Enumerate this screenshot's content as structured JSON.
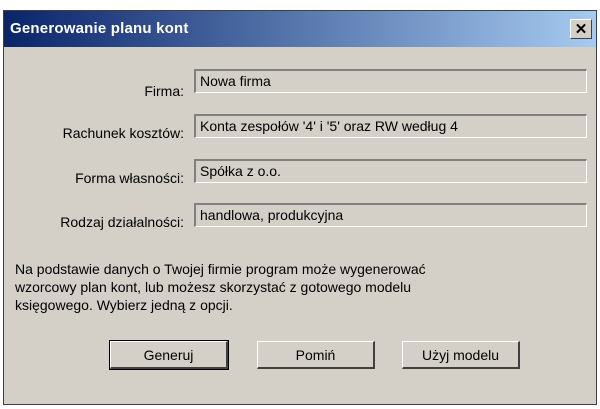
{
  "window": {
    "title": "Generowanie planu kont",
    "close_label": "✕"
  },
  "form": {
    "firma": {
      "label": "Firma:",
      "value": "Nowa firma"
    },
    "rachunek": {
      "label": "Rachunek kosztów:",
      "value": "Konta zespołów '4' i '5' oraz RW według 4"
    },
    "forma": {
      "label": "Forma własności:",
      "value": "Spółka z o.o."
    },
    "rodzaj": {
      "label": "Rodzaj działalności:",
      "value": "handlowa, produkcyjna"
    }
  },
  "info_lines": [
    "Na podstawie danych o Twojej firmie program może wygenerować",
    "wzorcowy plan kont, lub możesz skorzystać z gotowego modelu",
    "księgowego. Wybierz jedną z opcji."
  ],
  "buttons": {
    "generate": "Generuj",
    "skip": "Pomiń",
    "use_model": "Użyj modelu"
  }
}
